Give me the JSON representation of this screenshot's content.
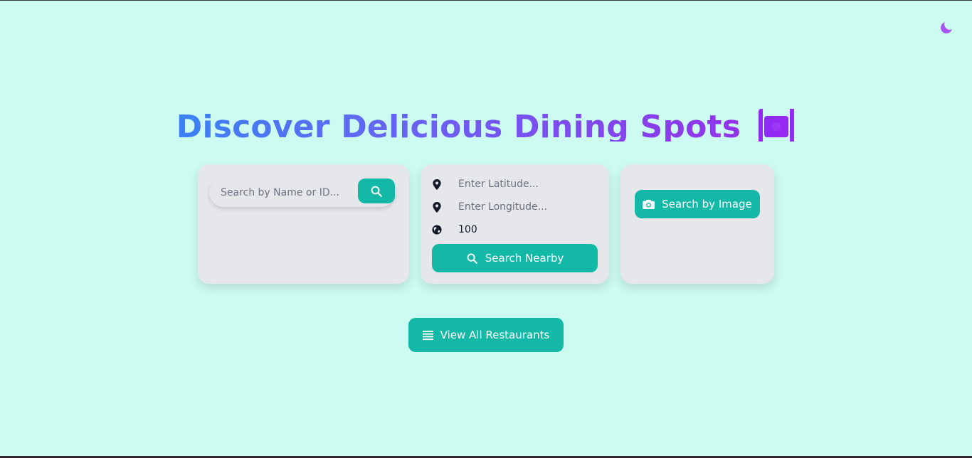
{
  "header": {
    "title": "Discover Delicious Dining Spots",
    "title_icon": "utensils-plate-icon",
    "theme_toggle_icon": "moon-icon"
  },
  "name_search": {
    "placeholder": "Search by Name or ID...",
    "value": "",
    "button_icon": "search-icon"
  },
  "geo_search": {
    "latitude": {
      "placeholder": "Enter Latitude...",
      "value": "",
      "icon": "map-pin-icon"
    },
    "longitude": {
      "placeholder": "Enter Longitude...",
      "value": "",
      "icon": "map-pin-icon"
    },
    "radius": {
      "value": "100",
      "icon": "globe-icon"
    },
    "button_label": "Search Nearby",
    "button_icon": "search-icon"
  },
  "image_search": {
    "button_label": "Search by Image",
    "button_icon": "camera-icon"
  },
  "view_all": {
    "button_label": "View All Restaurants",
    "button_icon": "list-icon"
  },
  "colors": {
    "background": "#ccfbf1",
    "card": "#e5e7eb",
    "accent": "#14b8a6",
    "title_gradient_start": "#3b82f6",
    "title_gradient_end": "#9333ea",
    "moon": "#a855f7"
  }
}
